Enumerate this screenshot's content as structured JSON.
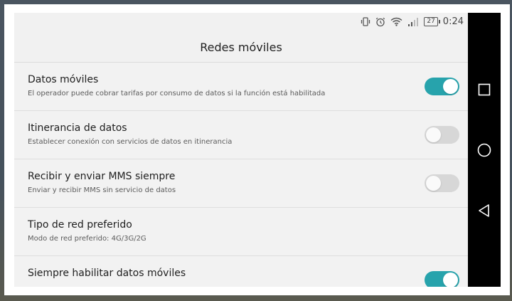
{
  "status_bar": {
    "icons": [
      "vibrate-icon",
      "alarm-icon",
      "wifi-icon",
      "signal-icon"
    ],
    "battery": "27",
    "time": "0:24"
  },
  "header": {
    "title": "Redes móviles"
  },
  "settings": [
    {
      "title": "Datos móviles",
      "subtitle": "El operador puede cobrar tarifas por consumo de datos si la función está habilitada",
      "toggle": true
    },
    {
      "title": "Itinerancia de datos",
      "subtitle": "Establecer conexión con servicios de datos en itinerancia",
      "toggle": false
    },
    {
      "title": "Recibir y enviar MMS siempre",
      "subtitle": "Enviar y recibir MMS sin servicio de datos",
      "toggle": false
    },
    {
      "title": "Tipo de red preferido",
      "subtitle": "Modo de red preferido: 4G/3G/2G"
    },
    {
      "title": "Siempre habilitar datos móviles",
      "toggle": true
    }
  ],
  "nav": {
    "icons": [
      "recents-icon",
      "home-icon",
      "back-icon"
    ]
  },
  "colors": {
    "accent": "#27a3ac",
    "background": "#f2f2f2",
    "navbar": "#000000"
  }
}
